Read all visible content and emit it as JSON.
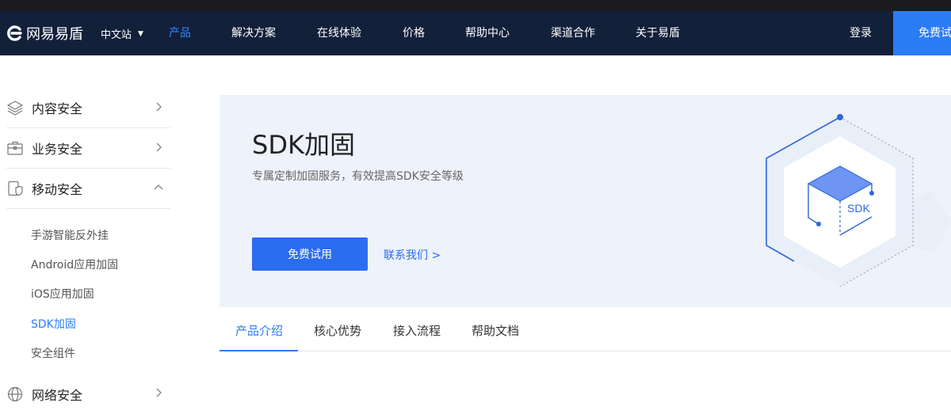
{
  "header": {
    "logo_text": "网易易盾",
    "lang_label": "中文站",
    "nav": [
      {
        "label": "产品",
        "active": true
      },
      {
        "label": "解决方案"
      },
      {
        "label": "在线体验"
      },
      {
        "label": "价格"
      },
      {
        "label": "帮助中心"
      },
      {
        "label": "渠道合作"
      },
      {
        "label": "关于易盾"
      }
    ],
    "login_label": "登录",
    "trial_label": "免费试用"
  },
  "sidebar": {
    "categories": [
      {
        "label": "内容安全",
        "icon": "layers-icon",
        "expanded": false
      },
      {
        "label": "业务安全",
        "icon": "briefcase-icon",
        "expanded": false
      },
      {
        "label": "移动安全",
        "icon": "mobile-shield-icon",
        "expanded": true
      },
      {
        "label": "网络安全",
        "icon": "globe-icon",
        "expanded": false
      }
    ],
    "subitems": [
      {
        "label": "手游智能反外挂"
      },
      {
        "label": "Android应用加固"
      },
      {
        "label": "iOS应用加固"
      },
      {
        "label": "SDK加固",
        "active": true
      },
      {
        "label": "安全组件"
      }
    ]
  },
  "hero": {
    "title": "SDK加固",
    "subtitle": "专属定制加固服务，有效提高SDK安全等级",
    "primary_button": "免费试用",
    "contact_link": "联系我们 >",
    "art_label": "SDK"
  },
  "tabs": [
    {
      "label": "产品介绍",
      "active": true
    },
    {
      "label": "核心优势"
    },
    {
      "label": "接入流程"
    },
    {
      "label": "帮助文档"
    }
  ],
  "colors": {
    "nav_bg": "#12203a",
    "accent": "#2c7cf6",
    "hero_bg": "#edf2fb"
  }
}
